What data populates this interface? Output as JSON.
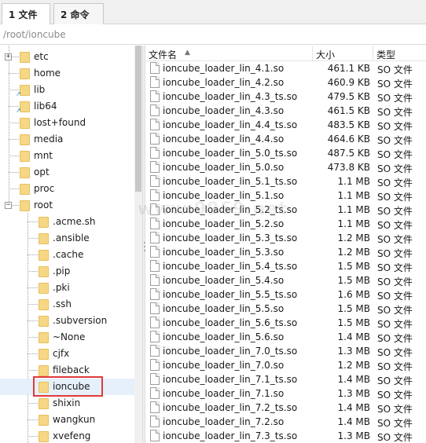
{
  "tabs": [
    {
      "label": "1 文件",
      "active": true
    },
    {
      "label": "2 命令",
      "active": false
    }
  ],
  "path": {
    "value": "/root/ioncube"
  },
  "tree": {
    "top_items": [
      {
        "label": "etc",
        "expandable": true,
        "link": false
      },
      {
        "label": "home",
        "expandable": false,
        "link": false
      },
      {
        "label": "lib",
        "expandable": false,
        "link": true
      },
      {
        "label": "lib64",
        "expandable": false,
        "link": true
      },
      {
        "label": "lost+found",
        "expandable": false,
        "link": false
      },
      {
        "label": "media",
        "expandable": false,
        "link": false
      },
      {
        "label": "mnt",
        "expandable": false,
        "link": false
      },
      {
        "label": "opt",
        "expandable": false,
        "link": false
      },
      {
        "label": "proc",
        "expandable": false,
        "link": false
      },
      {
        "label": "root",
        "expandable": true,
        "expanded": true,
        "link": false
      }
    ],
    "root_children": [
      {
        "label": ".acme.sh"
      },
      {
        "label": ".ansible"
      },
      {
        "label": ".cache"
      },
      {
        "label": ".pip"
      },
      {
        "label": ".pki"
      },
      {
        "label": ".ssh"
      },
      {
        "label": ".subversion"
      },
      {
        "label": "~None"
      },
      {
        "label": "cjfx"
      },
      {
        "label": "fileback"
      },
      {
        "label": "ioncube",
        "selected": true
      },
      {
        "label": "shixin"
      },
      {
        "label": "wangkun"
      },
      {
        "label": "xvefeng"
      }
    ]
  },
  "filelist": {
    "columns": {
      "name": "文件名",
      "size": "大小",
      "type": "类型"
    },
    "sort_icon": "sort-ascending-icon",
    "files": [
      {
        "name": "ioncube_loader_lin_4.1.so",
        "size": "461.1 KB",
        "type": "SO 文件"
      },
      {
        "name": "ioncube_loader_lin_4.2.so",
        "size": "460.9 KB",
        "type": "SO 文件"
      },
      {
        "name": "ioncube_loader_lin_4.3_ts.so",
        "size": "479.5 KB",
        "type": "SO 文件"
      },
      {
        "name": "ioncube_loader_lin_4.3.so",
        "size": "461.5 KB",
        "type": "SO 文件"
      },
      {
        "name": "ioncube_loader_lin_4.4_ts.so",
        "size": "483.5 KB",
        "type": "SO 文件"
      },
      {
        "name": "ioncube_loader_lin_4.4.so",
        "size": "464.6 KB",
        "type": "SO 文件"
      },
      {
        "name": "ioncube_loader_lin_5.0_ts.so",
        "size": "487.5 KB",
        "type": "SO 文件"
      },
      {
        "name": "ioncube_loader_lin_5.0.so",
        "size": "473.8 KB",
        "type": "SO 文件"
      },
      {
        "name": "ioncube_loader_lin_5.1_ts.so",
        "size": "1.1 MB",
        "type": "SO 文件"
      },
      {
        "name": "ioncube_loader_lin_5.1.so",
        "size": "1.1 MB",
        "type": "SO 文件"
      },
      {
        "name": "ioncube_loader_lin_5.2_ts.so",
        "size": "1.1 MB",
        "type": "SO 文件"
      },
      {
        "name": "ioncube_loader_lin_5.2.so",
        "size": "1.1 MB",
        "type": "SO 文件"
      },
      {
        "name": "ioncube_loader_lin_5.3_ts.so",
        "size": "1.2 MB",
        "type": "SO 文件"
      },
      {
        "name": "ioncube_loader_lin_5.3.so",
        "size": "1.2 MB",
        "type": "SO 文件"
      },
      {
        "name": "ioncube_loader_lin_5.4_ts.so",
        "size": "1.5 MB",
        "type": "SO 文件"
      },
      {
        "name": "ioncube_loader_lin_5.4.so",
        "size": "1.5 MB",
        "type": "SO 文件"
      },
      {
        "name": "ioncube_loader_lin_5.5_ts.so",
        "size": "1.6 MB",
        "type": "SO 文件"
      },
      {
        "name": "ioncube_loader_lin_5.5.so",
        "size": "1.5 MB",
        "type": "SO 文件"
      },
      {
        "name": "ioncube_loader_lin_5.6_ts.so",
        "size": "1.5 MB",
        "type": "SO 文件"
      },
      {
        "name": "ioncube_loader_lin_5.6.so",
        "size": "1.4 MB",
        "type": "SO 文件"
      },
      {
        "name": "ioncube_loader_lin_7.0_ts.so",
        "size": "1.3 MB",
        "type": "SO 文件"
      },
      {
        "name": "ioncube_loader_lin_7.0.so",
        "size": "1.2 MB",
        "type": "SO 文件"
      },
      {
        "name": "ioncube_loader_lin_7.1_ts.so",
        "size": "1.4 MB",
        "type": "SO 文件"
      },
      {
        "name": "ioncube_loader_lin_7.1.so",
        "size": "1.3 MB",
        "type": "SO 文件"
      },
      {
        "name": "ioncube_loader_lin_7.2_ts.so",
        "size": "1.4 MB",
        "type": "SO 文件"
      },
      {
        "name": "ioncube_loader_lin_7.2.so",
        "size": "1.4 MB",
        "type": "SO 文件"
      },
      {
        "name": "ioncube_loader_lin_7.3_ts.so",
        "size": "1.3 MB",
        "type": "SO 文件"
      }
    ]
  },
  "colors": {
    "selection_outline": "#e03a3a",
    "folder": "#f5d785"
  }
}
